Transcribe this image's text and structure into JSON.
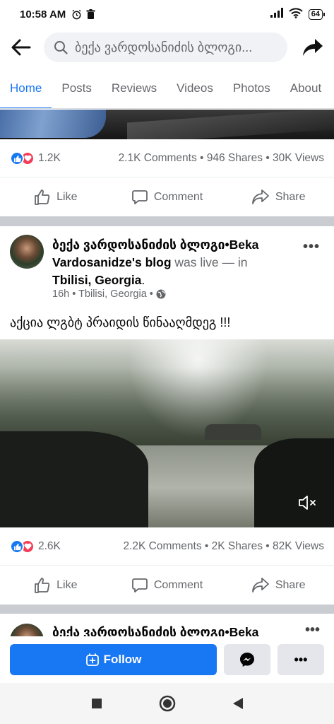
{
  "status_bar": {
    "time": "10:58 AM",
    "battery": "64",
    "icons": [
      "alarm-icon",
      "trash-icon",
      "signal-icon",
      "wifi-icon",
      "battery-icon"
    ]
  },
  "header": {
    "search_text": "ბექა ვარდოსანიძის ბლოგი...",
    "back_icon": "arrow-left-icon",
    "share_icon": "share-arrow-icon"
  },
  "tabs": [
    {
      "label": "Home",
      "active": true
    },
    {
      "label": "Posts",
      "active": false
    },
    {
      "label": "Reviews",
      "active": false
    },
    {
      "label": "Videos",
      "active": false
    },
    {
      "label": "Photos",
      "active": false
    },
    {
      "label": "About",
      "active": false
    }
  ],
  "post1": {
    "reaction_count": "1.2K",
    "stats": "2.1K Comments • 946 Shares • 30K Views"
  },
  "actions": {
    "like": "Like",
    "comment": "Comment",
    "share": "Share"
  },
  "post2": {
    "author_georgian": "ბექა ვარდოსანიძის ბლოგი•Beka",
    "author_latin": "Vardosanidze's blog",
    "was_live": " was live — in",
    "location_bold": "Tbilisi, Georgia",
    "location_period": ".",
    "meta": "16h • Tbilisi, Georgia •",
    "text": "აქცია ლგბტ პრაიდის წინააღმდეგ !!!",
    "reaction_count": "2.6K",
    "stats": "2.2K Comments • 2K Shares • 82K Views"
  },
  "post3": {
    "author_peek": "ბექა ვარდოსანიძის ბლოგი•Beka"
  },
  "bottom_bar": {
    "follow_label": "Follow"
  },
  "colors": {
    "accent": "#1877f2",
    "love": "#f33e58",
    "muted": "#65676b",
    "divider": "#c9ccd1"
  }
}
